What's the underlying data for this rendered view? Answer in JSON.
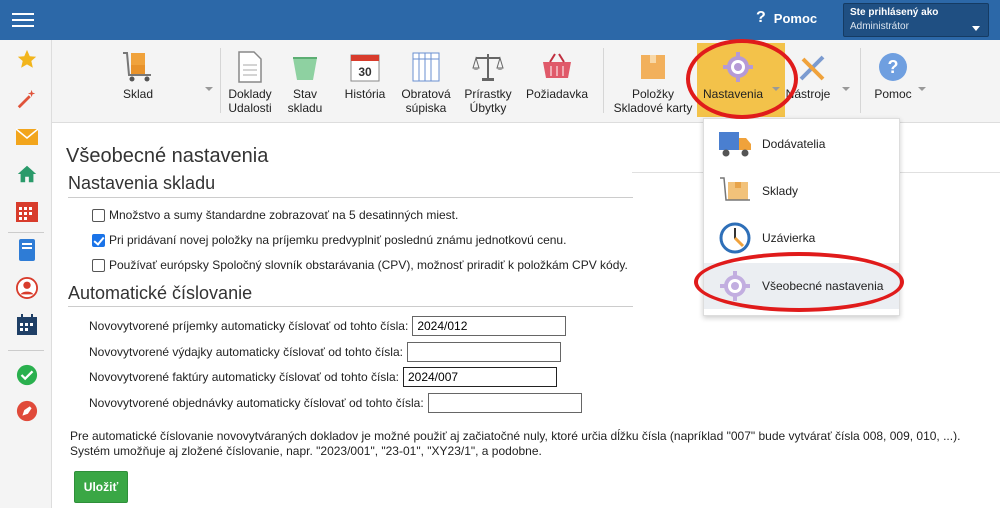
{
  "topbar": {
    "help_label": "Pomoc",
    "user_line1": "Ste prihlásený ako",
    "user_line2": "Administrátor"
  },
  "toolbar": {
    "items": [
      {
        "label": "Sklad",
        "icon": "cart-icon"
      },
      {
        "label": "Doklady\nUdalosti",
        "icon": "document-icon"
      },
      {
        "label": "Stav\nskladu",
        "icon": "stock-icon"
      },
      {
        "label": "História",
        "icon": "calendar-icon",
        "calendar_day": "30"
      },
      {
        "label": "Obratová\nsúpiska",
        "icon": "table-icon"
      },
      {
        "label": "Prírastky\nÚbytky",
        "icon": "scale-icon"
      },
      {
        "label": "Požiadavka",
        "icon": "basket-icon"
      },
      {
        "label": "Položky\nSkladové karty",
        "icon": "box-icon"
      },
      {
        "label": "Nastavenia",
        "icon": "gear-icon"
      },
      {
        "label": "Nástroje",
        "icon": "tools-icon"
      },
      {
        "label": "Pomoc",
        "icon": "help-icon"
      }
    ]
  },
  "dropdown": {
    "items": [
      {
        "label": "Dodávatelia",
        "icon": "truck-icon"
      },
      {
        "label": "Sklady",
        "icon": "warehouse-icon"
      },
      {
        "label": "Uzávierka",
        "icon": "clock-icon"
      },
      {
        "label": "Všeobecné nastavenia",
        "icon": "gear-icon"
      }
    ]
  },
  "page": {
    "title": "Všeobecné nastavenia",
    "section1_title": "Nastavenia skladu",
    "checkboxes": [
      {
        "label": "Množstvo a sumy štandardne zobrazovať na 5 desatinných miest.",
        "checked": false
      },
      {
        "label": "Pri pridávaní novej položky na príjemku predvyplniť poslednú známu jednotkovú cenu.",
        "checked": true
      },
      {
        "label": "Používať európsky Spoločný slovník obstarávania (CPV), možnosť priradiť k položkám CPV kódy.",
        "checked": false
      }
    ],
    "section2_title": "Automatické číslovanie",
    "numbering": [
      {
        "label": "Novovytvorené príjemky automaticky číslovať od tohto čísla:",
        "value": "2024/012"
      },
      {
        "label": "Novovytvorené výdajky automaticky číslovať od tohto čísla:",
        "value": ""
      },
      {
        "label": "Novovytvorené faktúry automaticky číslovať od tohto čísla:",
        "value": "2024/007"
      },
      {
        "label": "Novovytvorené objednávky automaticky číslovať od tohto čísla:",
        "value": ""
      }
    ],
    "note_line1": "Pre automatické číslovanie novovytváraných dokladov je možné použiť aj začiatočné nuly, ktoré určia dĺžku čísla (napríklad \"007\" bude vytvárať čísla 008, 009, 010, ...).",
    "note_line2": "Systém umožňuje aj zložené číslovanie, napr. \"2023/001\", \"23-01\", \"XY23/1\", a podobne.",
    "save_label": "Uložiť"
  },
  "colors": {
    "topbar": "#2c68a8",
    "active_menu": "#f3c24a",
    "save_button": "#3aa745",
    "annotation_ring": "#e01b1b"
  }
}
